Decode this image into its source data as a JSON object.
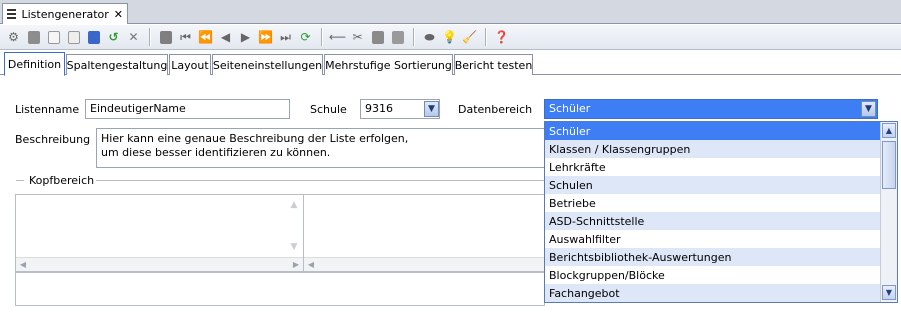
{
  "window": {
    "tab_title": "Listengenerator",
    "close_glyph": "✕"
  },
  "tabs": [
    {
      "label": "Definition"
    },
    {
      "label": "Spaltengestaltung"
    },
    {
      "label": "Layout"
    },
    {
      "label": "Seiteneinstellungen"
    },
    {
      "label": "Mehrstufige Sortierung"
    },
    {
      "label": "Bericht testen"
    }
  ],
  "form": {
    "listenname_label": "Listenname",
    "listenname_value": "EindeutigerName",
    "schule_label": "Schule",
    "schule_value": "9316",
    "datenbereich_label": "Datenbereich",
    "datenbereich_value": "Schüler",
    "beschreibung_label": "Beschreibung",
    "beschreibung_line1": "Hier kann eine genaue Beschreibung der Liste erfolgen,",
    "beschreibung_line2": "um diese besser identifizieren zu können.",
    "kopfbereich_label": "Kopfbereich"
  },
  "dropdown": {
    "items": [
      "Schüler",
      "Klassen / Klassengruppen",
      "Lehrkräfte",
      "Schulen",
      "Betriebe",
      "ASD-Schnittstelle",
      "Auswahlfilter",
      "Berichtsbibliothek-Auswertungen",
      "Blockgruppen/Blöcke",
      "Fachangebot"
    ],
    "selected": "Schüler"
  },
  "colors": {
    "selection": "#3d7ef5",
    "row_alt": "#dde7f7",
    "active_tab_border": "#3b6ec9"
  }
}
